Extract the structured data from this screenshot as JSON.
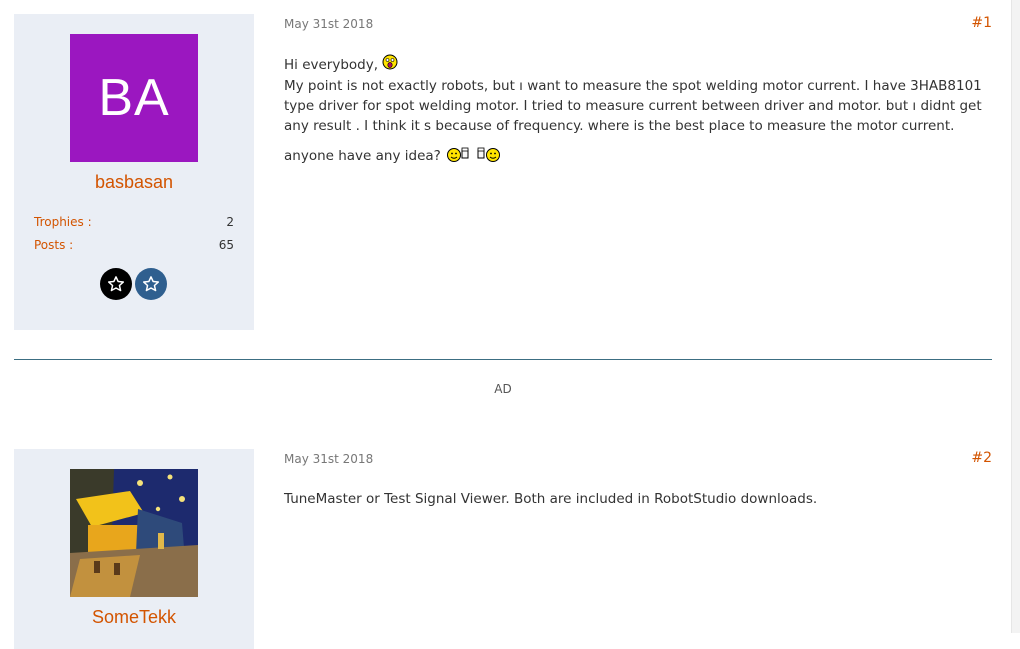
{
  "posts": [
    {
      "username": "basbasan",
      "avatar_initials": "BA",
      "avatar_color": "#9b17c0",
      "stats": [
        {
          "label": "Trophies :",
          "value": "2"
        },
        {
          "label": "Posts :",
          "value": "65"
        }
      ],
      "badges": [
        "star-outline-black",
        "star-outline-blue"
      ],
      "date": "May 31st 2018",
      "number": "#1",
      "greeting": "Hi everybody,",
      "body": "My point is not exactly robots, but ı want to measure the spot welding motor current. I have 3HAB8101 type driver for spot welding motor. I tried to measure current between driver and motor. but ı didnt get any result . I think it s because of frequency. where is the best place to measure the motor current.",
      "closing": "anyone have any idea?"
    },
    {
      "username": "SomeTekk",
      "avatar_image": "painting-cafe-terrace-at-night",
      "date": "May 31st 2018",
      "number": "#2",
      "body": "TuneMaster or Test Signal Viewer. Both are included in RobotStudio downloads."
    }
  ],
  "ad_label": "AD",
  "colors": {
    "accent": "#d35400",
    "userbox_bg": "#eaeef5",
    "divider": "#3c6e82"
  }
}
